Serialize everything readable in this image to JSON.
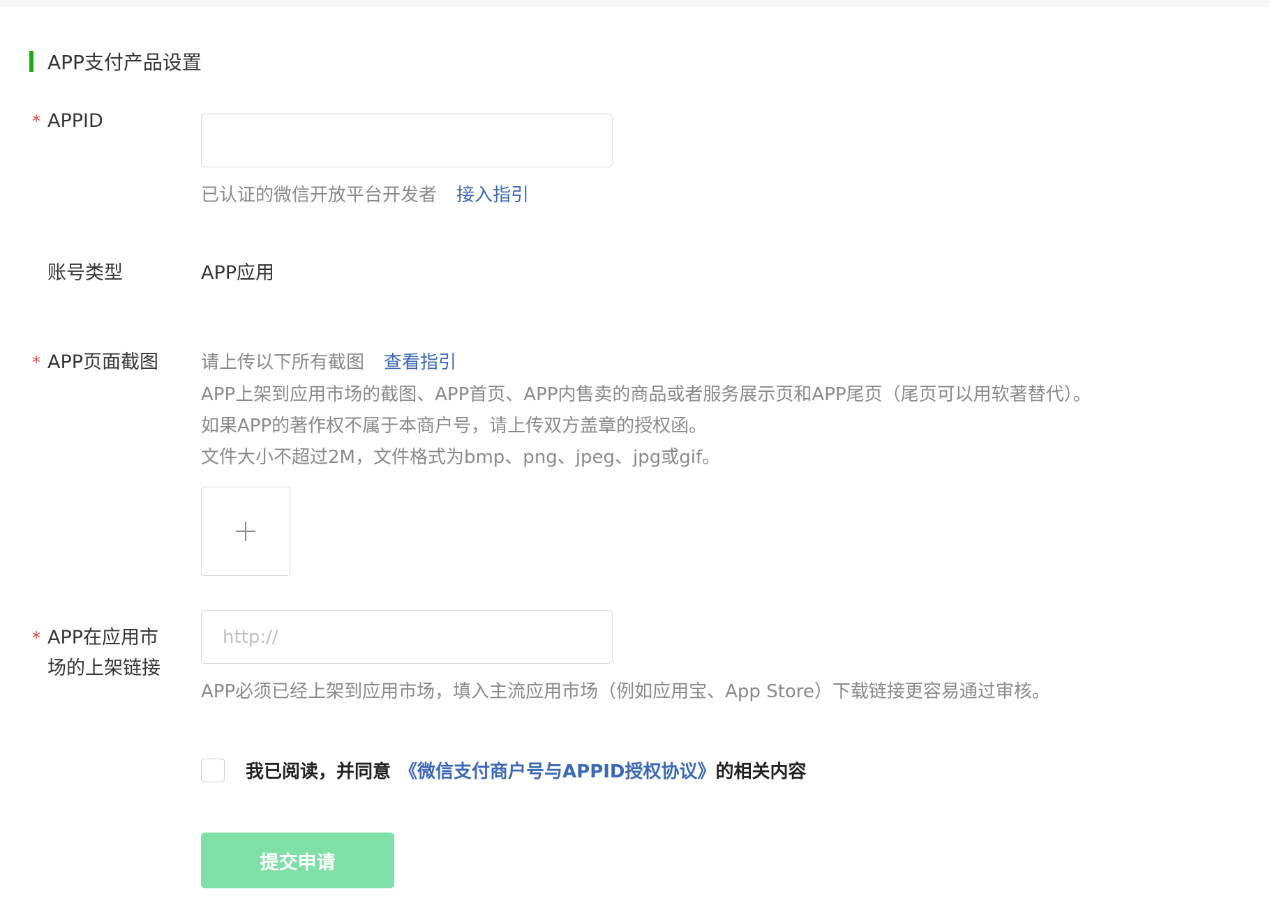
{
  "section": {
    "title": "APP支付产品设置"
  },
  "appid": {
    "required_mark": "*",
    "label": "APPID",
    "value": "",
    "hint": "已认证的微信开放平台开发者",
    "link": "接入指引"
  },
  "account_type": {
    "label": "账号类型",
    "value": "APP应用"
  },
  "screenshots": {
    "required_mark": "*",
    "label": "APP页面截图",
    "hint": "请上传以下所有截图",
    "link": "查看指引",
    "desc_1": "APP上架到应用市场的截图、APP首页、APP内售卖的商品或者服务展示页和APP尾页（尾页可以用软著替代）。",
    "desc_2": "如果APP的著作权不属于本商户号，请上传双方盖章的授权函。",
    "desc_3": "文件大小不超过2M，文件格式为bmp、png、jpeg、jpg或gif。",
    "upload_icon": "plus-icon"
  },
  "market_link": {
    "required_mark": "*",
    "label_line1": "APP在应用市",
    "label_line2": "场的上架链接",
    "placeholder": "http://",
    "value": "",
    "hint": "APP必须已经上架到应用市场，填入主流应用市场（例如应用宝、App Store）下载链接更容易通过审核。"
  },
  "agreement": {
    "checked": false,
    "prefix": "我已阅读，并同意",
    "link": "《微信支付商户号与APPID授权协议》",
    "suffix": "的相关内容"
  },
  "submit": {
    "label": "提交申请"
  },
  "colors": {
    "accent_green": "#1aad19",
    "button_disabled": "#7fe0a7",
    "link_blue": "#3c69b7",
    "required_red": "#e64340"
  }
}
